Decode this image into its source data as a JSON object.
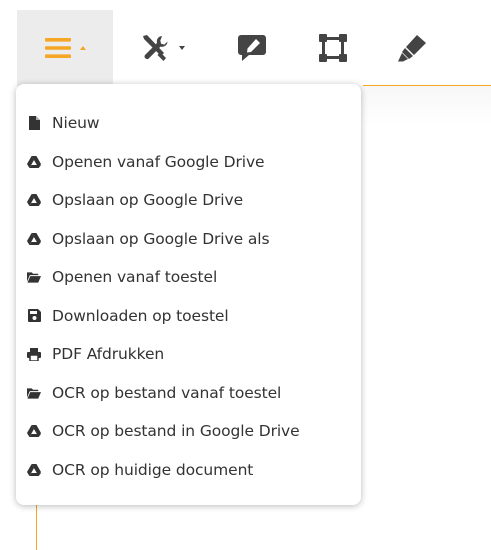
{
  "toolbar": {
    "buttons": [
      {
        "name": "menu-button",
        "icon": "hamburger-icon",
        "color": "#f5a623",
        "active": true
      },
      {
        "name": "tools-button",
        "icon": "tools-icon",
        "color": "#444444"
      },
      {
        "name": "comment-edit-button",
        "icon": "comment-edit-icon",
        "color": "#444444"
      },
      {
        "name": "frame-button",
        "icon": "vector-square-icon",
        "color": "#444444"
      },
      {
        "name": "highlighter-button",
        "icon": "highlighter-icon",
        "color": "#444444"
      }
    ]
  },
  "menu": {
    "items": [
      {
        "label": "Nieuw",
        "icon": "file-icon"
      },
      {
        "label": "Openen vanaf Google Drive",
        "icon": "google-drive-icon"
      },
      {
        "label": "Opslaan op Google Drive",
        "icon": "google-drive-icon"
      },
      {
        "label": "Opslaan op Google Drive als",
        "icon": "google-drive-icon"
      },
      {
        "label": "Openen vanaf toestel",
        "icon": "folder-open-icon"
      },
      {
        "label": "Downloaden op toestel",
        "icon": "save-icon"
      },
      {
        "label": "PDF Afdrukken",
        "icon": "print-icon"
      },
      {
        "label": "OCR op bestand vanaf toestel",
        "icon": "folder-open-icon"
      },
      {
        "label": "OCR op bestand in Google Drive",
        "icon": "google-drive-icon"
      },
      {
        "label": "OCR op huidige document",
        "icon": "google-drive-icon"
      }
    ]
  },
  "colors": {
    "accent": "#f5a623",
    "icon": "#333333",
    "text": "#333333"
  }
}
